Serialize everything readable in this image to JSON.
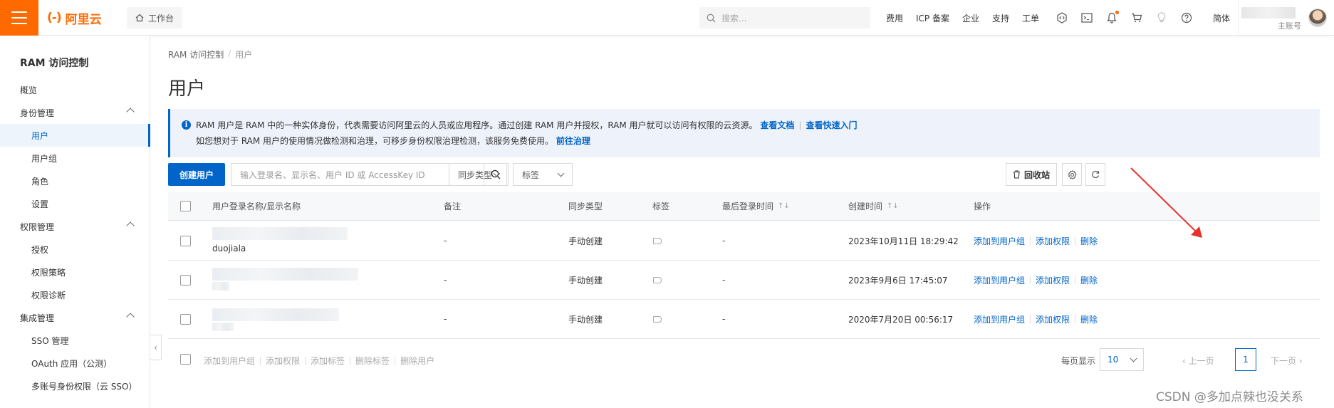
{
  "topbar": {
    "brand": "阿里云",
    "workbench": "工作台",
    "search_placeholder": "搜索...",
    "links": [
      "费用",
      "ICP 备案",
      "企业",
      "支持",
      "工单"
    ],
    "lang": "简体",
    "role": "主账号",
    "accent": "#ff6a00"
  },
  "sidebar": {
    "title": "RAM 访问控制",
    "overview": "概览",
    "groups": {
      "identity": "身份管理",
      "permission": "权限管理",
      "integration": "集成管理"
    },
    "items": {
      "users": "用户",
      "user_groups": "用户组",
      "roles": "角色",
      "settings": "设置",
      "grants": "授权",
      "policies": "权限策略",
      "diagnosis": "权限诊断",
      "sso": "SSO 管理",
      "oauth": "OAuth 应用（公测）",
      "multi_sso": "多账号身份权限（云 SSO）"
    }
  },
  "breadcrumb": {
    "root": "RAM 访问控制",
    "sep": "/",
    "current": "用户"
  },
  "page": {
    "title": "用户"
  },
  "notice": {
    "line1": "RAM 用户是 RAM 中的一种实体身份，代表需要访问阿里云的人员或应用程序。通过创建 RAM 用户并授权，RAM 用户就可以访问有权限的云资源。",
    "link_docs": "查看文档",
    "link_quickstart": "查看快速入门",
    "line2": "如您想对于 RAM 用户的使用情况做检测和治理，可移步身份权限治理检测，该服务免费使用。",
    "link_govern": "前往治理"
  },
  "toolbar": {
    "create": "创建用户",
    "search_placeholder": "输入登录名、显示名、用户 ID 或 AccessKey ID",
    "sync_type": "同步类型",
    "tag": "标签",
    "recycle": "回收站"
  },
  "table": {
    "headers": {
      "name": "用户登录名称/显示名称",
      "remark": "备注",
      "sync": "同步类型",
      "tag": "标签",
      "last_login": "最后登录时间",
      "created": "创建时间",
      "ops": "操作"
    },
    "rows": [
      {
        "display_name": "duojiala",
        "remark": "-",
        "sync": "手动创建",
        "last_login": "-",
        "created": "2023年10月11日 18:29:42"
      },
      {
        "display_name": "",
        "remark": "-",
        "sync": "手动创建",
        "last_login": "-",
        "created": "2023年9月6日 17:45:07"
      },
      {
        "display_name": "",
        "remark": "-",
        "sync": "手动创建",
        "last_login": "-",
        "created": "2020年7月20日 00:56:17"
      }
    ],
    "ops": {
      "add_group": "添加到用户组",
      "add_perm": "添加权限",
      "delete": "删除"
    }
  },
  "footer": {
    "batch": [
      "添加到用户组",
      "添加权限",
      "添加标签",
      "删除标签",
      "删除用户"
    ],
    "page_size_label": "每页显示",
    "page_size": "10",
    "prev": "上一页",
    "page": "1",
    "next": "下一页"
  },
  "watermark": "CSDN @多加点辣也没关系",
  "colors": {
    "primary": "#0064c8",
    "annotation_arrow": "#e8302c"
  }
}
